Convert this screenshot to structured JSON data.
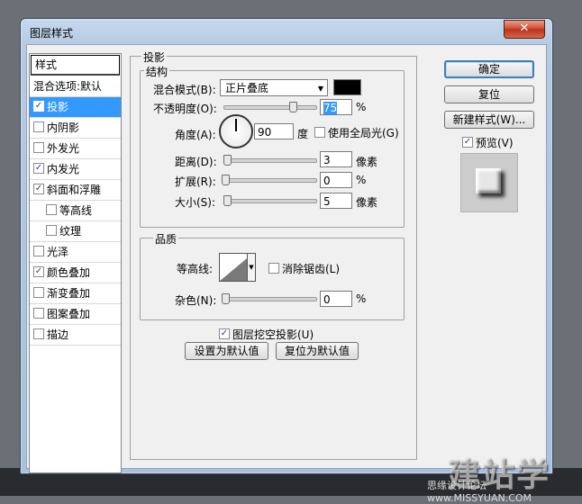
{
  "window": {
    "title": "图层样式",
    "close_label": "✕"
  },
  "styles_list": {
    "header": "样式",
    "items": [
      {
        "label": "混合选项:默认",
        "has_checkbox": false,
        "checked": false,
        "indent": false,
        "selected": false
      },
      {
        "label": "投影",
        "has_checkbox": true,
        "checked": true,
        "indent": false,
        "selected": true
      },
      {
        "label": "内阴影",
        "has_checkbox": true,
        "checked": false,
        "indent": false,
        "selected": false
      },
      {
        "label": "外发光",
        "has_checkbox": true,
        "checked": false,
        "indent": false,
        "selected": false
      },
      {
        "label": "内发光",
        "has_checkbox": true,
        "checked": true,
        "indent": false,
        "selected": false
      },
      {
        "label": "斜面和浮雕",
        "has_checkbox": true,
        "checked": true,
        "indent": false,
        "selected": false
      },
      {
        "label": "等高线",
        "has_checkbox": true,
        "checked": false,
        "indent": true,
        "selected": false
      },
      {
        "label": "纹理",
        "has_checkbox": true,
        "checked": false,
        "indent": true,
        "selected": false
      },
      {
        "label": "光泽",
        "has_checkbox": true,
        "checked": false,
        "indent": false,
        "selected": false
      },
      {
        "label": "颜色叠加",
        "has_checkbox": true,
        "checked": true,
        "indent": false,
        "selected": false
      },
      {
        "label": "渐变叠加",
        "has_checkbox": true,
        "checked": false,
        "indent": false,
        "selected": false
      },
      {
        "label": "图案叠加",
        "has_checkbox": true,
        "checked": false,
        "indent": false,
        "selected": false
      },
      {
        "label": "描边",
        "has_checkbox": true,
        "checked": false,
        "indent": false,
        "selected": false
      }
    ]
  },
  "drop_shadow": {
    "section_title": "投影",
    "structure": {
      "title": "结构",
      "blend_mode_label": "混合模式(B):",
      "blend_mode_value": "正片叠底",
      "shadow_color": "#000000",
      "opacity_label": "不透明度(O):",
      "opacity_value": "75",
      "opacity_unit": "%",
      "opacity_fraction": 0.75,
      "angle_label": "角度(A):",
      "angle_value": "90",
      "angle_unit": "度",
      "global_light_label": "使用全局光(G)",
      "global_light_checked": false,
      "distance_label": "距离(D):",
      "distance_value": "3",
      "distance_unit": "像素",
      "spread_label": "扩展(R):",
      "spread_value": "0",
      "spread_unit": "%",
      "size_label": "大小(S):",
      "size_value": "5",
      "size_unit": "像素"
    },
    "quality": {
      "title": "品质",
      "contour_label": "等高线:",
      "anti_alias_label": "消除锯齿(L)",
      "anti_alias_checked": false,
      "noise_label": "杂色(N):",
      "noise_value": "0",
      "noise_unit": "%"
    },
    "knockout_label": "图层挖空投影(U)",
    "knockout_checked": true,
    "make_default_label": "设置为默认值",
    "reset_default_label": "复位为默认值"
  },
  "buttons": {
    "ok": "确定",
    "reset": "复位",
    "new_style": "新建样式(W)...",
    "preview_label": "预览(V)",
    "preview_checked": true
  },
  "watermark": {
    "big": "建站学",
    "small": "思缘设计论坛 www.MISSYUAN.COM"
  }
}
